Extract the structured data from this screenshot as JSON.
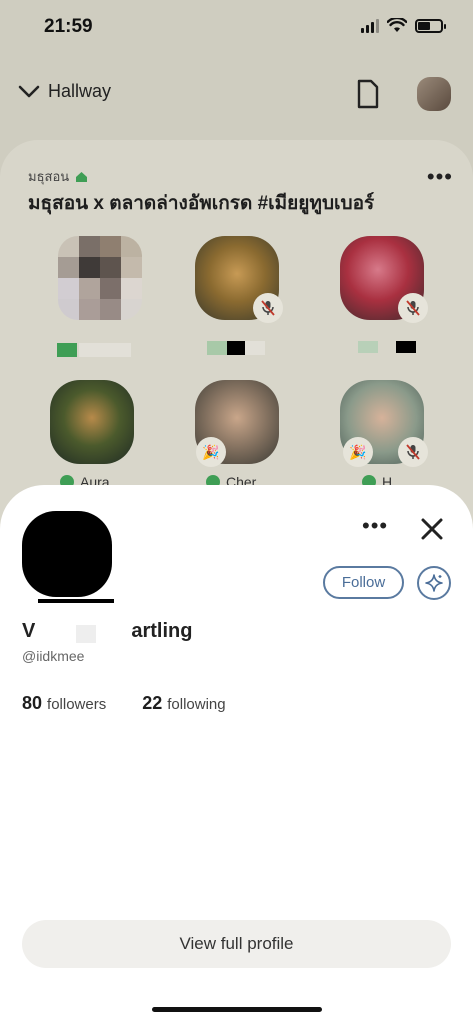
{
  "status": {
    "time": "21:59"
  },
  "nav": {
    "room_label": "Hallway"
  },
  "room": {
    "club_name": "มธุสอน",
    "title": "มธุสอน x ตลาดล่างอัพเกรด #เมียยูทูบเบอร์",
    "speakers": [
      {
        "name": "",
        "muted": false
      },
      {
        "name": "",
        "muted": true
      },
      {
        "name": "",
        "muted": true
      },
      {
        "name": "Aura",
        "muted": false
      },
      {
        "name": "Cher",
        "muted": false
      },
      {
        "name": "H",
        "muted": true
      }
    ]
  },
  "profile": {
    "name_prefix": "V",
    "name_suffix": "artling",
    "handle": "@iidkmee",
    "followers_count": "80",
    "followers_label": "followers",
    "following_count": "22",
    "following_label": "following",
    "follow_label": "Follow",
    "view_full_profile_label": "View full profile"
  },
  "colors": {
    "accent": "#5a7aa0",
    "club_green": "#3f9e55",
    "dim_background": "#cfcdc0"
  }
}
